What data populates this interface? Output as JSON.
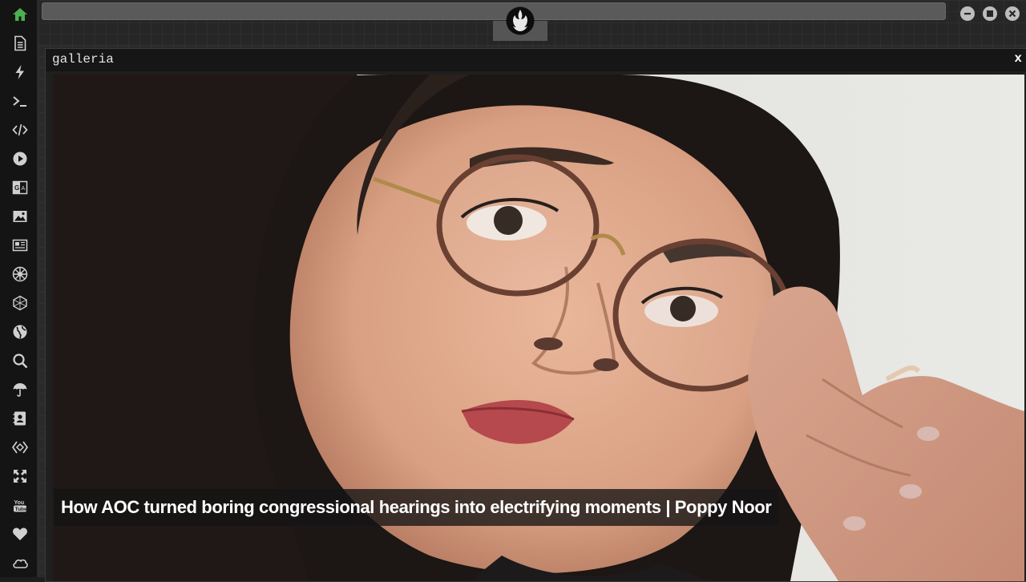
{
  "sidebar": {
    "items": [
      {
        "icon": "home-icon",
        "color": "#4caf50"
      },
      {
        "icon": "document-icon"
      },
      {
        "icon": "lightning-icon"
      },
      {
        "icon": "terminal-icon"
      },
      {
        "icon": "code-icon"
      },
      {
        "icon": "play-icon"
      },
      {
        "icon": "translate-icon"
      },
      {
        "icon": "image-icon"
      },
      {
        "icon": "newspaper-icon"
      },
      {
        "icon": "galactic-empire-icon"
      },
      {
        "icon": "hexagon-icon"
      },
      {
        "icon": "globe-icon"
      },
      {
        "icon": "search-icon"
      },
      {
        "icon": "umbrella-icon"
      },
      {
        "icon": "contact-icon"
      },
      {
        "icon": "diamond-code-icon"
      },
      {
        "icon": "expand-icon"
      },
      {
        "icon": "youtube-icon"
      },
      {
        "icon": "heart-icon"
      },
      {
        "icon": "cloud-icon"
      }
    ]
  },
  "topbar": {
    "logo": "rebel-alliance-icon",
    "window_controls": [
      "minimize",
      "maximize",
      "close"
    ]
  },
  "gallery": {
    "title": "galleria",
    "close_label": "x",
    "caption": "How AOC turned boring congressional hearings into electrifying moments | Poppy Noor"
  },
  "colors": {
    "accent": "#4caf50",
    "sidebar_bg": "#141414",
    "icon": "#d0d0d0"
  }
}
